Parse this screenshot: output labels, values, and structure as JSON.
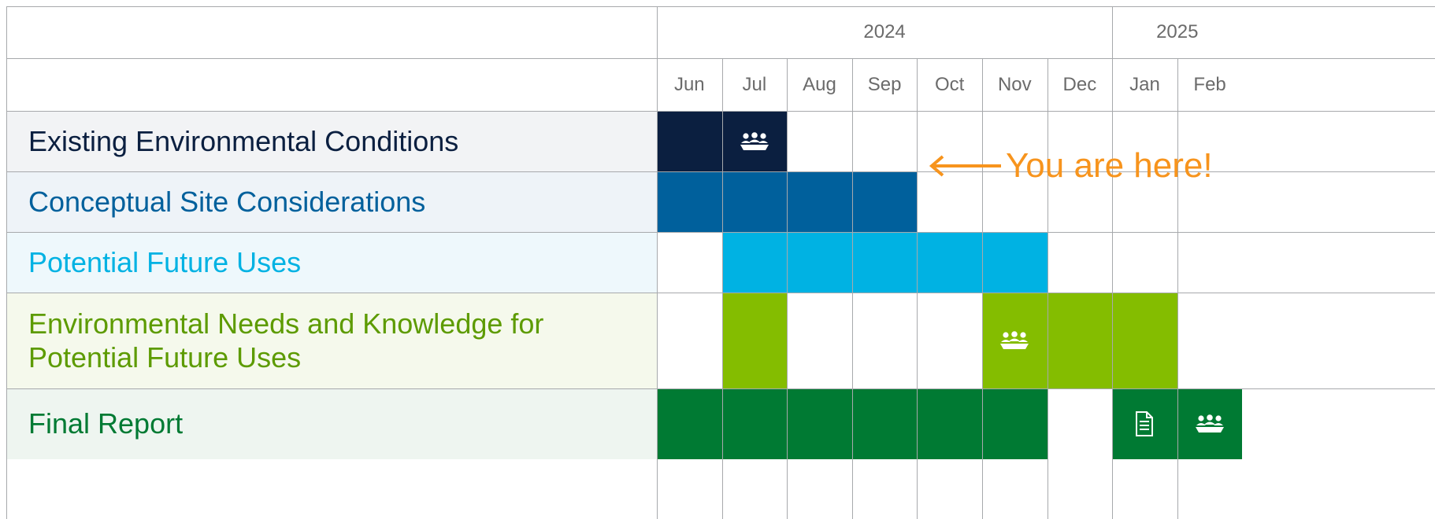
{
  "chart_data": {
    "type": "gantt",
    "years": [
      {
        "label": "2024",
        "span": [
          "Jun",
          "Dec"
        ]
      },
      {
        "label": "2025",
        "span": [
          "Jan",
          "Feb"
        ]
      }
    ],
    "months": [
      "Jun",
      "Jul",
      "Aug",
      "Sep",
      "Oct",
      "Nov",
      "Dec",
      "Jan",
      "Feb"
    ],
    "tasks": [
      {
        "label": "Existing Environmental Conditions",
        "color": "#0b1f40",
        "label_color": "#0b1f40",
        "label_bg": "#f2f3f5",
        "active_months": [
          "Jun",
          "Jul"
        ],
        "icons": [
          {
            "month": "Jul",
            "icon": "meeting-icon"
          }
        ]
      },
      {
        "label": "Conceptual Site Considerations",
        "color": "#00609c",
        "label_color": "#00609c",
        "label_bg": "#eef3f8",
        "active_months": [
          "Jun",
          "Jul",
          "Aug",
          "Sep"
        ],
        "icons": []
      },
      {
        "label": "Potential Future Uses",
        "color": "#00b2e3",
        "label_color": "#00b2e3",
        "label_bg": "#eef8fc",
        "active_months": [
          "Jul",
          "Aug",
          "Sep",
          "Oct",
          "Nov"
        ],
        "icons": []
      },
      {
        "label": "Environmental Needs and Knowledge for\nPotential Future Uses",
        "color": "#84bd00",
        "label_color": "#5d9b00",
        "label_bg": "#f5f9ec",
        "active_months": [
          "Jul",
          "Nov",
          "Dec",
          "Jan"
        ],
        "icons": [
          {
            "month": "Nov",
            "icon": "meeting-icon"
          }
        ]
      },
      {
        "label": "Final Report",
        "color": "#007a33",
        "label_color": "#007a33",
        "label_bg": "#eef5f0",
        "active_months": [
          "Jun",
          "Jul",
          "Aug",
          "Sep",
          "Oct",
          "Nov",
          "Jan",
          "Feb"
        ],
        "icons": [
          {
            "month": "Jan",
            "icon": "document-icon"
          },
          {
            "month": "Feb",
            "icon": "meeting-icon"
          }
        ]
      }
    ],
    "annotation": {
      "text": "You are here!",
      "color": "#f7941d",
      "row": "Existing Environmental Conditions",
      "points_to": "Jul"
    }
  }
}
